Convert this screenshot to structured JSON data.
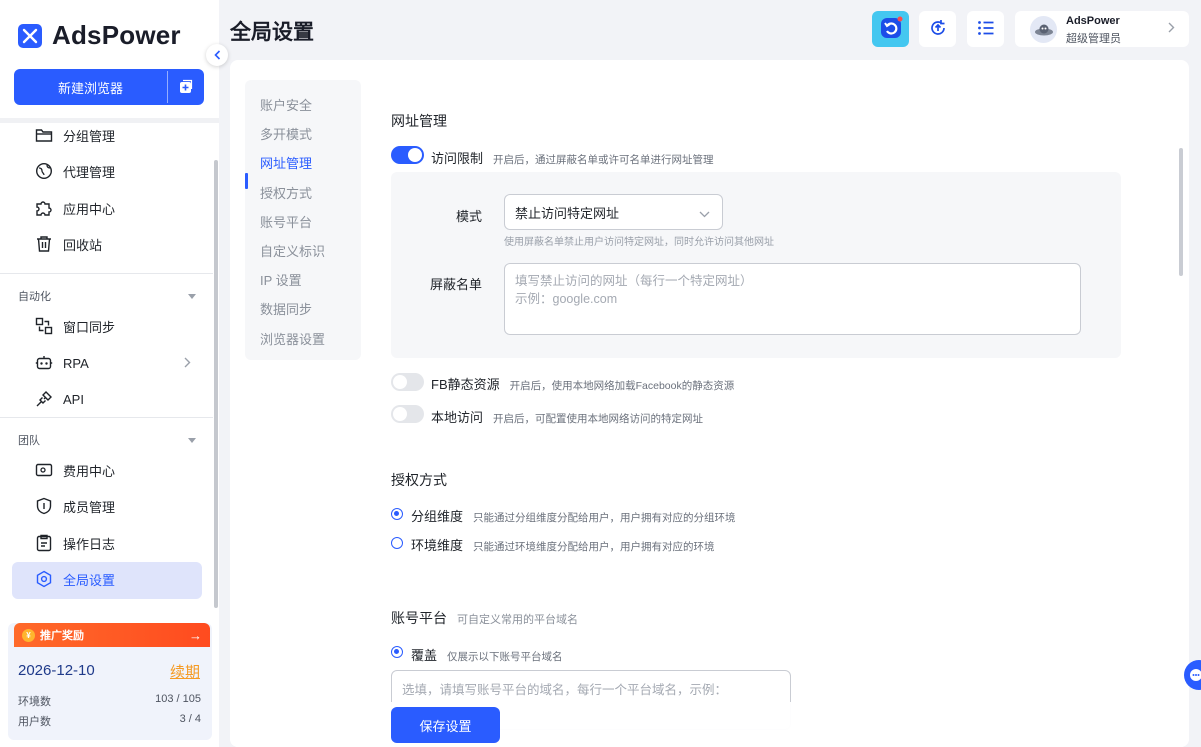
{
  "brand": {
    "name": "AdsPower"
  },
  "sidebar": {
    "new_browser_label": "新建浏览器",
    "items": [
      {
        "label": "分组管理",
        "icon": "folder-icon"
      },
      {
        "label": "代理管理",
        "icon": "globe-icon"
      },
      {
        "label": "应用中心",
        "icon": "puzzle-icon"
      },
      {
        "label": "回收站",
        "icon": "trash-icon"
      }
    ],
    "section_automation": "自动化",
    "automation_items": [
      {
        "label": "窗口同步",
        "icon": "sync-windows-icon"
      },
      {
        "label": "RPA",
        "icon": "robot-icon"
      },
      {
        "label": "API",
        "icon": "plug-icon"
      }
    ],
    "section_team": "团队",
    "team_items": [
      {
        "label": "费用中心",
        "icon": "wallet-icon"
      },
      {
        "label": "成员管理",
        "icon": "shield-user-icon"
      },
      {
        "label": "操作日志",
        "icon": "clipboard-icon"
      },
      {
        "label": "全局设置",
        "icon": "settings-hex-icon"
      }
    ],
    "promo": {
      "title": "推广奖励",
      "arrow": "→",
      "date": "2026-12-10",
      "renew": "续期",
      "env_label": "环境数",
      "env_value": "103 / 105",
      "user_label": "用户数",
      "user_value": "3 / 4"
    }
  },
  "header": {
    "title": "全局设置",
    "user_name": "AdsPower",
    "user_role": "超级管理员"
  },
  "submenu": [
    "账户安全",
    "多开模式",
    "网址管理",
    "授权方式",
    "账号平台",
    "自定义标识",
    "IP 设置",
    "数据同步",
    "浏览器设置"
  ],
  "url_mgmt": {
    "title": "网址管理",
    "access_limit": {
      "label": "访问限制",
      "desc": "开启后，通过屏蔽名单或许可名单进行网址管理",
      "enabled": true
    },
    "mode_label": "模式",
    "mode_value": "禁止访问特定网址",
    "mode_hint": "使用屏蔽名单禁止用户访问特定网址，同时允许访问其他网址",
    "blocklist_label": "屏蔽名单",
    "blocklist_placeholder_1": "填写禁止访问的网址（每行一个特定网址）",
    "blocklist_placeholder_2": "示例：google.com",
    "fb_static": {
      "label": "FB静态资源",
      "desc": "开启后，使用本地网络加载Facebook的静态资源",
      "enabled": false
    },
    "local_access": {
      "label": "本地访问",
      "desc": "开启后，可配置使用本地网络访问的特定网址",
      "enabled": false
    }
  },
  "auth": {
    "title": "授权方式",
    "options": [
      {
        "label": "分组维度",
        "desc": "只能通过分组维度分配给用户，用户拥有对应的分组环境",
        "checked": true
      },
      {
        "label": "环境维度",
        "desc": "只能通过环境维度分配给用户，用户拥有对应的环境",
        "checked": false
      }
    ]
  },
  "platform": {
    "title": "账号平台",
    "subtitle": "可自定义常用的平台域名",
    "cover_label": "覆盖",
    "cover_desc": "仅展示以下账号平台域名",
    "placeholder": "选填，请填写账号平台的域名，每行一个平台域名，示例："
  },
  "save_label": "保存设置",
  "colors": {
    "accent": "#2a5cff",
    "promo": "#ff5a24",
    "renew": "#f59a23"
  }
}
